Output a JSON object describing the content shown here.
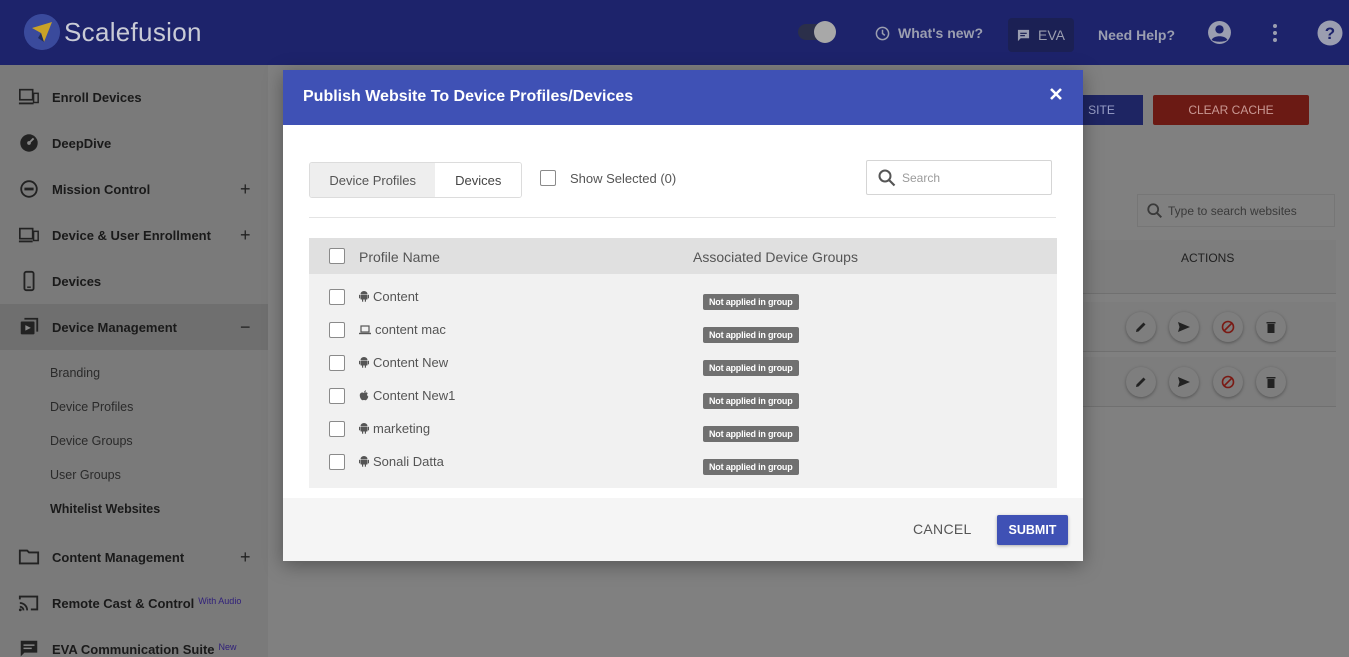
{
  "topbar": {
    "brand": "Scalefusion",
    "whats_new": "What's new?",
    "eva": "EVA",
    "need_help": "Need Help?",
    "theme_toggle_on": true
  },
  "sidebar": {
    "items": [
      {
        "label": "Enroll Devices",
        "icon": "enroll-icon"
      },
      {
        "label": "DeepDive",
        "icon": "dashboard-icon"
      },
      {
        "label": "Mission Control",
        "icon": "mission-icon",
        "expand": "+"
      },
      {
        "label": "Device & User Enrollment",
        "icon": "enrollment-icon",
        "expand": "+"
      },
      {
        "label": "Devices",
        "icon": "phone-icon"
      },
      {
        "label": "Device Management",
        "icon": "device-management-icon",
        "expand": "−"
      },
      {
        "label": "Content Management",
        "icon": "folder-icon",
        "expand": "+"
      },
      {
        "label": "Remote Cast & Control",
        "icon": "cast-icon",
        "sup": "With Audio"
      },
      {
        "label": "EVA Communication Suite",
        "icon": "chat-icon",
        "sup": "New"
      }
    ],
    "sub_items": [
      "Branding",
      "Device Profiles",
      "Device Groups",
      "User Groups",
      "Whitelist Websites"
    ]
  },
  "background": {
    "btn_site": "SITE",
    "btn_clear_cache": "CLEAR CACHE",
    "search_placeholder": "Type to search websites",
    "actions_header": "ACTIONS"
  },
  "modal": {
    "title": "Publish Website To Device Profiles/Devices",
    "tabs": [
      "Device Profiles",
      "Devices"
    ],
    "show_selected": "Show Selected (0)",
    "search_placeholder": "Search",
    "columns": [
      "Profile Name",
      "Associated Device Groups"
    ],
    "rows": [
      {
        "name": "Content",
        "os": "android-icon",
        "group": "Not applied in group"
      },
      {
        "name": "content mac",
        "os": "laptop-icon",
        "group": "Not applied in group"
      },
      {
        "name": "Content New",
        "os": "android-icon",
        "group": "Not applied in group"
      },
      {
        "name": "Content New1",
        "os": "apple-icon",
        "group": "Not applied in group"
      },
      {
        "name": "marketing",
        "os": "android-icon",
        "group": "Not applied in group"
      },
      {
        "name": "Sonali Datta",
        "os": "android-icon",
        "group": "Not applied in group"
      }
    ],
    "cancel": "CANCEL",
    "submit": "SUBMIT"
  },
  "colors": {
    "topbar": "#1d236b",
    "modal_header": "#3f51b5",
    "submit": "#3f51b5",
    "clear_cache": "#c62828"
  }
}
